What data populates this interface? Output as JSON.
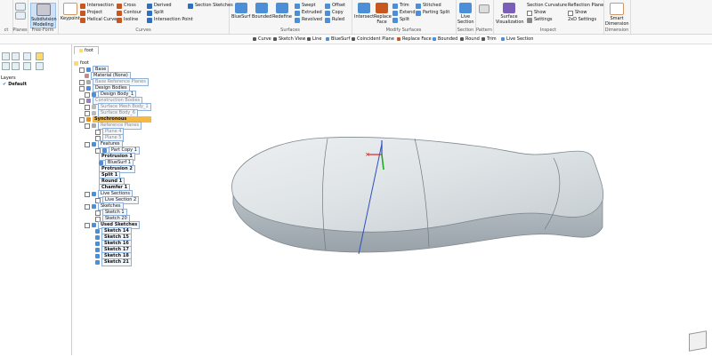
{
  "ribbon": {
    "groups": {
      "planes": "Planes",
      "freeform": "Free-Form",
      "curves": "Curves",
      "surfaces": "Surfaces",
      "modify": "Modify Surfaces",
      "section": "Section",
      "pattern": "Pattern",
      "inspect": "Inspect",
      "dimension": "Dimension"
    },
    "subdivision": "Subdivision Modeling",
    "keypoint": "Keypoint",
    "curves": [
      "Intersection",
      "Project",
      "Helical Curve",
      "Cross",
      "Contour",
      "Isoline",
      "Derived",
      "Split",
      "Intersection Point",
      "Section Sketches"
    ],
    "surfaces": [
      "BlueSurf",
      "Bounded",
      "Redefine",
      "Swept",
      "Extruded",
      "Revolved",
      "Offset",
      "Copy",
      "Ruled"
    ],
    "modify": [
      "Intersect",
      "Replace Face",
      "Trim",
      "Extend",
      "Split",
      "Stitched",
      "Parting Split"
    ],
    "live_section": "Live Section",
    "surface_viz": "Surface Visualization",
    "inspect": {
      "section_curvature": "Section Curvature",
      "show": "Show",
      "settings": "Settings",
      "reflection_plane": "Reflection Plane",
      "show2": "Show",
      "settings2": "2xD Settings"
    },
    "smart_dimension": "Smart Dimension"
  },
  "commands": [
    "Curve",
    "Sketch View",
    "Line",
    "BlueSurf",
    "Coincident Plane",
    "Replace Face",
    "Bounded",
    "Round",
    "Trim",
    "Live Section"
  ],
  "left_panel": {
    "layers": "Layers",
    "default": "Default"
  },
  "tree": {
    "tab": "foot",
    "rows": [
      {
        "label": "foot"
      },
      {
        "label": "Base"
      },
      {
        "label": "Material (None)"
      },
      {
        "label": "Base Reference Planes"
      },
      {
        "label": "Design Bodies"
      },
      {
        "label": "Design Body_1"
      },
      {
        "label": "Construction Bodies"
      },
      {
        "label": "Surface Mesh Body_1"
      },
      {
        "label": "Surface Body_6"
      },
      {
        "label": "Synchronous"
      },
      {
        "label": "Reference Planes"
      },
      {
        "label": "Plane 4"
      },
      {
        "label": "Plane 5"
      },
      {
        "label": "Features"
      },
      {
        "label": "Part Copy 1"
      },
      {
        "label": "Protrusion 1"
      },
      {
        "label": "BlueSurf 1"
      },
      {
        "label": "Protrusion 2"
      },
      {
        "label": "Split 1"
      },
      {
        "label": "Round 1"
      },
      {
        "label": "Chamfer 1"
      },
      {
        "label": "Live Sections"
      },
      {
        "label": "Live Section 2"
      },
      {
        "label": "Sketches"
      },
      {
        "label": "Sketch 1"
      },
      {
        "label": "Sketch 20"
      },
      {
        "label": "Used Sketches"
      },
      {
        "label": "Sketch 14"
      },
      {
        "label": "Sketch 15"
      },
      {
        "label": "Sketch 16"
      },
      {
        "label": "Sketch 17"
      },
      {
        "label": "Sketch 18"
      },
      {
        "label": "Sketch 21"
      }
    ]
  },
  "colors": {
    "accent": "#2f6fc0",
    "selection": "#f4b942",
    "model": "#c9d0d4"
  }
}
